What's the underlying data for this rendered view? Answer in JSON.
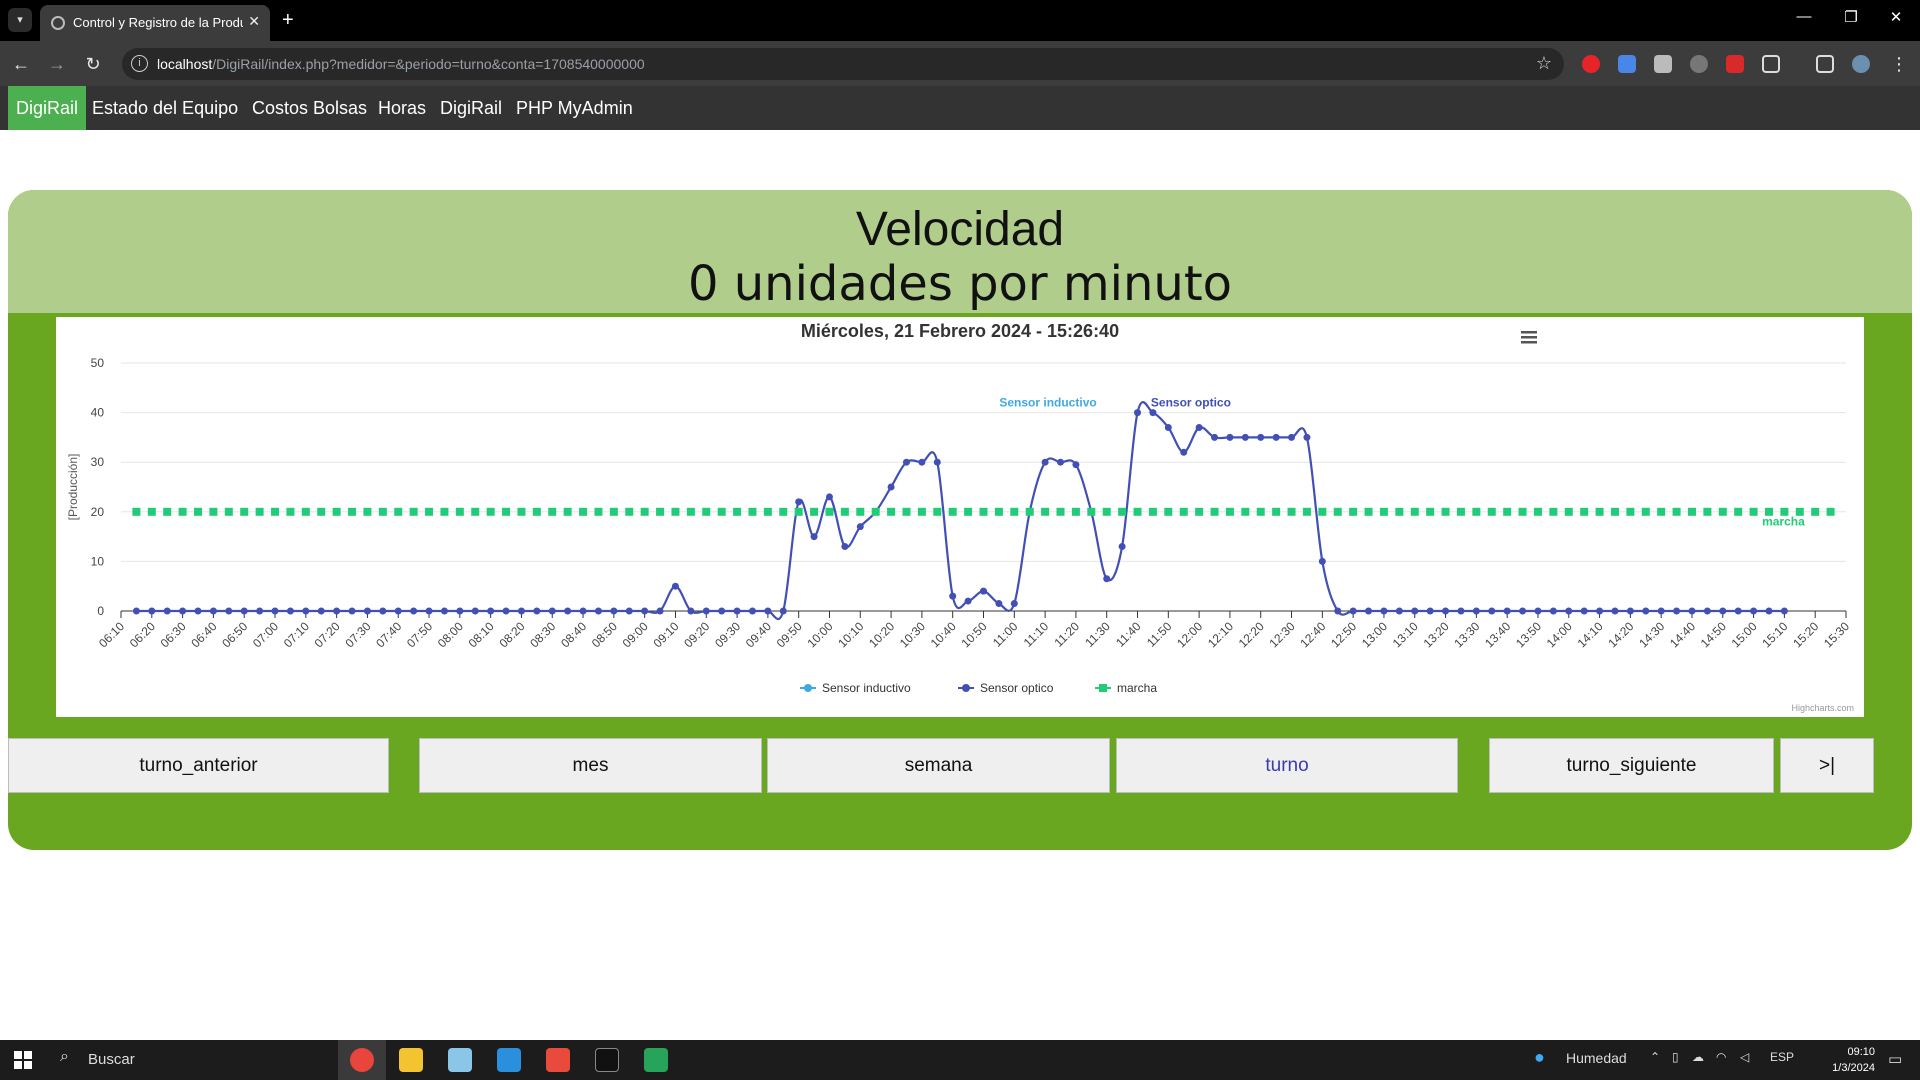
{
  "browser": {
    "tab_title": "Control y Registro de la Producción",
    "url_host": "localhost",
    "url_path": "/DigiRail/index.php?medidor=&periodo=turno&conta=1708540000000",
    "icons": [
      "tab-list-icon",
      "close-icon",
      "plus-icon",
      "minimize-icon",
      "restore-icon",
      "window-close-icon",
      "back-icon",
      "forward-icon",
      "reload-icon",
      "site-info-icon",
      "star-icon",
      "extensions-icon",
      "side-panel-icon",
      "profile-icon",
      "menu-icon"
    ]
  },
  "nav": {
    "items": [
      "DigiRail",
      "Estado del Equipo",
      "Costos Bolsas",
      "Horas",
      "DigiRail",
      "PHP MyAdmin"
    ],
    "active_index": 0,
    "active_color": "#4caf50"
  },
  "panel": {
    "title": "Velocidad",
    "subtitle": "0 unidades por minuto",
    "header_color": "#b1cd8c",
    "body_color": "#6aa720"
  },
  "chart": {
    "title": "Miércoles, 21 Febrero 2024 - 15:26:40",
    "credits": "Highcharts.com",
    "menu_icon": "hamburger-menu-icon"
  },
  "chart_data": {
    "type": "line",
    "title": "Miércoles, 21 Febrero 2024 - 15:26:40",
    "ylabel": "[Producción]",
    "xlabel": "",
    "ylim": [
      0,
      50
    ],
    "yticks": [
      0,
      10,
      20,
      30,
      40,
      50
    ],
    "grid": true,
    "legend_position": "bottom-center",
    "x": [
      "06:10",
      "06:15",
      "06:20",
      "06:25",
      "06:30",
      "06:35",
      "06:40",
      "06:45",
      "06:50",
      "06:55",
      "07:00",
      "07:05",
      "07:10",
      "07:15",
      "07:20",
      "07:25",
      "07:30",
      "07:35",
      "07:40",
      "07:45",
      "07:50",
      "07:55",
      "08:00",
      "08:05",
      "08:10",
      "08:15",
      "08:20",
      "08:25",
      "08:30",
      "08:35",
      "08:40",
      "08:45",
      "08:50",
      "08:55",
      "09:00",
      "09:05",
      "09:10",
      "09:15",
      "09:20",
      "09:25",
      "09:30",
      "09:35",
      "09:40",
      "09:45",
      "09:50",
      "09:55",
      "10:00",
      "10:05",
      "10:10",
      "10:15",
      "10:20",
      "10:25",
      "10:30",
      "10:35",
      "10:40",
      "10:45",
      "10:50",
      "10:55",
      "11:00",
      "11:05",
      "11:10",
      "11:15",
      "11:20",
      "11:25",
      "11:30",
      "11:35",
      "11:40",
      "11:45",
      "11:50",
      "11:55",
      "12:00",
      "12:05",
      "12:10",
      "12:15",
      "12:20",
      "12:25",
      "12:30",
      "12:35",
      "12:40",
      "12:45",
      "12:50",
      "12:55",
      "13:00",
      "13:05",
      "13:10",
      "13:15",
      "13:20",
      "13:25",
      "13:30",
      "13:35",
      "13:40",
      "13:45",
      "13:50",
      "13:55",
      "14:00",
      "14:05",
      "14:10",
      "14:15",
      "14:20",
      "14:25",
      "14:30",
      "14:35",
      "14:40",
      "14:45",
      "14:50",
      "14:55",
      "15:00",
      "15:05",
      "15:10",
      "15:15",
      "15:20",
      "15:25",
      "15:30"
    ],
    "x_tick_labels": [
      "06:10",
      "06:20",
      "06:30",
      "06:40",
      "06:50",
      "07:00",
      "07:10",
      "07:20",
      "07:30",
      "07:40",
      "07:50",
      "08:00",
      "08:10",
      "08:20",
      "08:30",
      "08:40",
      "08:50",
      "09:00",
      "09:10",
      "09:20",
      "09:30",
      "09:40",
      "09:50",
      "10:00",
      "10:10",
      "10:20",
      "10:30",
      "10:40",
      "10:50",
      "11:00",
      "11:10",
      "11:20",
      "11:30",
      "11:40",
      "11:50",
      "12:00",
      "12:10",
      "12:20",
      "12:30",
      "12:40",
      "12:50",
      "13:00",
      "13:10",
      "13:20",
      "13:30",
      "13:40",
      "13:50",
      "14:00",
      "14:10",
      "14:20",
      "14:30",
      "14:40",
      "14:50",
      "15:00",
      "15:10",
      "15:20",
      "15:30"
    ],
    "series": [
      {
        "name": "Sensor inductivo",
        "color": "#3fa9e6",
        "marker": "circle",
        "label_pos": [
          11.5,
          42
        ]
      },
      {
        "name": "Sensor optico",
        "color": "#4250b5",
        "marker": "circle",
        "label_pos": [
          11.75,
          42
        ],
        "values": [
          null,
          0,
          0,
          0,
          0,
          0,
          0,
          0,
          0,
          0,
          0,
          0,
          0,
          0,
          0,
          0,
          0,
          0,
          0,
          0,
          0,
          0,
          0,
          0,
          0,
          0,
          0,
          0,
          0,
          0,
          0,
          0,
          0,
          0,
          0,
          0,
          5,
          0,
          0,
          0,
          0,
          0,
          0,
          0,
          22,
          15,
          23,
          13,
          17,
          20,
          25,
          30,
          30,
          30,
          3,
          2,
          4,
          1.5,
          1.5,
          20,
          30,
          30,
          29.5,
          20,
          6.5,
          13,
          40,
          40,
          37,
          32,
          37,
          35,
          35,
          35,
          35,
          35,
          35,
          35,
          10,
          0,
          0,
          0,
          0,
          0,
          0,
          0,
          0,
          0,
          0,
          0,
          0,
          0,
          0,
          0,
          0,
          0,
          0,
          0,
          0,
          0,
          0,
          0,
          0,
          0,
          0,
          0,
          0,
          0,
          0,
          null
        ]
      },
      {
        "name": "marcha",
        "color": "#22cc77",
        "marker": "square",
        "constant": 20,
        "label_pos": [
          15.25,
          18
        ]
      }
    ]
  },
  "buttons": [
    {
      "label": "turno_anterior",
      "color": "#111111"
    },
    {
      "label": "mes",
      "color": "#111111"
    },
    {
      "label": "semana",
      "color": "#111111"
    },
    {
      "label": "turno",
      "color": "#3b3bb0"
    },
    {
      "label": "turno_siguiente",
      "color": "#111111"
    },
    {
      "label": ">|",
      "color": "#111111"
    }
  ],
  "taskbar": {
    "search_placeholder": "Buscar",
    "weather": "Humedad",
    "language": "ESP",
    "time": "09:10",
    "date": "1/3/2024",
    "icons": [
      "windows-start-icon",
      "search-icon",
      "chrome-icon",
      "file-explorer-icon",
      "notepad-icon",
      "vscode-icon",
      "git-icon",
      "terminal-icon",
      "drive-icon",
      "water-drop-icon",
      "chevron-up-icon",
      "wifi-icon",
      "cloud-icon",
      "volume-muted-icon",
      "notification-icon"
    ]
  }
}
